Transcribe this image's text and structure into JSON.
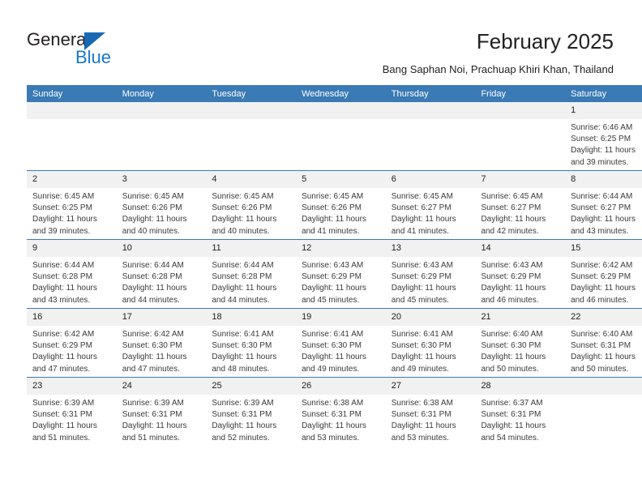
{
  "logo": {
    "word_top": "General",
    "word_bottom": "Blue",
    "triangle_color": "#1668b3",
    "bottom_color": "#1678c8"
  },
  "header": {
    "title": "February 2025",
    "subtitle": "Bang Saphan Noi, Prachuap Khiri Khan, Thailand",
    "accent_color": "#3a7ab5",
    "daynum_band_color": "#f1f1f1"
  },
  "weekday_headers": [
    "Sunday",
    "Monday",
    "Tuesday",
    "Wednesday",
    "Thursday",
    "Friday",
    "Saturday"
  ],
  "weeks": [
    [
      {
        "day": "",
        "lines": []
      },
      {
        "day": "",
        "lines": []
      },
      {
        "day": "",
        "lines": []
      },
      {
        "day": "",
        "lines": []
      },
      {
        "day": "",
        "lines": []
      },
      {
        "day": "",
        "lines": []
      },
      {
        "day": "1",
        "lines": [
          "Sunrise: 6:46 AM",
          "Sunset: 6:25 PM",
          "Daylight: 11 hours",
          "and 39 minutes."
        ]
      }
    ],
    [
      {
        "day": "2",
        "lines": [
          "Sunrise: 6:45 AM",
          "Sunset: 6:25 PM",
          "Daylight: 11 hours",
          "and 39 minutes."
        ]
      },
      {
        "day": "3",
        "lines": [
          "Sunrise: 6:45 AM",
          "Sunset: 6:26 PM",
          "Daylight: 11 hours",
          "and 40 minutes."
        ]
      },
      {
        "day": "4",
        "lines": [
          "Sunrise: 6:45 AM",
          "Sunset: 6:26 PM",
          "Daylight: 11 hours",
          "and 40 minutes."
        ]
      },
      {
        "day": "5",
        "lines": [
          "Sunrise: 6:45 AM",
          "Sunset: 6:26 PM",
          "Daylight: 11 hours",
          "and 41 minutes."
        ]
      },
      {
        "day": "6",
        "lines": [
          "Sunrise: 6:45 AM",
          "Sunset: 6:27 PM",
          "Daylight: 11 hours",
          "and 41 minutes."
        ]
      },
      {
        "day": "7",
        "lines": [
          "Sunrise: 6:45 AM",
          "Sunset: 6:27 PM",
          "Daylight: 11 hours",
          "and 42 minutes."
        ]
      },
      {
        "day": "8",
        "lines": [
          "Sunrise: 6:44 AM",
          "Sunset: 6:27 PM",
          "Daylight: 11 hours",
          "and 43 minutes."
        ]
      }
    ],
    [
      {
        "day": "9",
        "lines": [
          "Sunrise: 6:44 AM",
          "Sunset: 6:28 PM",
          "Daylight: 11 hours",
          "and 43 minutes."
        ]
      },
      {
        "day": "10",
        "lines": [
          "Sunrise: 6:44 AM",
          "Sunset: 6:28 PM",
          "Daylight: 11 hours",
          "and 44 minutes."
        ]
      },
      {
        "day": "11",
        "lines": [
          "Sunrise: 6:44 AM",
          "Sunset: 6:28 PM",
          "Daylight: 11 hours",
          "and 44 minutes."
        ]
      },
      {
        "day": "12",
        "lines": [
          "Sunrise: 6:43 AM",
          "Sunset: 6:29 PM",
          "Daylight: 11 hours",
          "and 45 minutes."
        ]
      },
      {
        "day": "13",
        "lines": [
          "Sunrise: 6:43 AM",
          "Sunset: 6:29 PM",
          "Daylight: 11 hours",
          "and 45 minutes."
        ]
      },
      {
        "day": "14",
        "lines": [
          "Sunrise: 6:43 AM",
          "Sunset: 6:29 PM",
          "Daylight: 11 hours",
          "and 46 minutes."
        ]
      },
      {
        "day": "15",
        "lines": [
          "Sunrise: 6:42 AM",
          "Sunset: 6:29 PM",
          "Daylight: 11 hours",
          "and 46 minutes."
        ]
      }
    ],
    [
      {
        "day": "16",
        "lines": [
          "Sunrise: 6:42 AM",
          "Sunset: 6:29 PM",
          "Daylight: 11 hours",
          "and 47 minutes."
        ]
      },
      {
        "day": "17",
        "lines": [
          "Sunrise: 6:42 AM",
          "Sunset: 6:30 PM",
          "Daylight: 11 hours",
          "and 47 minutes."
        ]
      },
      {
        "day": "18",
        "lines": [
          "Sunrise: 6:41 AM",
          "Sunset: 6:30 PM",
          "Daylight: 11 hours",
          "and 48 minutes."
        ]
      },
      {
        "day": "19",
        "lines": [
          "Sunrise: 6:41 AM",
          "Sunset: 6:30 PM",
          "Daylight: 11 hours",
          "and 49 minutes."
        ]
      },
      {
        "day": "20",
        "lines": [
          "Sunrise: 6:41 AM",
          "Sunset: 6:30 PM",
          "Daylight: 11 hours",
          "and 49 minutes."
        ]
      },
      {
        "day": "21",
        "lines": [
          "Sunrise: 6:40 AM",
          "Sunset: 6:30 PM",
          "Daylight: 11 hours",
          "and 50 minutes."
        ]
      },
      {
        "day": "22",
        "lines": [
          "Sunrise: 6:40 AM",
          "Sunset: 6:31 PM",
          "Daylight: 11 hours",
          "and 50 minutes."
        ]
      }
    ],
    [
      {
        "day": "23",
        "lines": [
          "Sunrise: 6:39 AM",
          "Sunset: 6:31 PM",
          "Daylight: 11 hours",
          "and 51 minutes."
        ]
      },
      {
        "day": "24",
        "lines": [
          "Sunrise: 6:39 AM",
          "Sunset: 6:31 PM",
          "Daylight: 11 hours",
          "and 51 minutes."
        ]
      },
      {
        "day": "25",
        "lines": [
          "Sunrise: 6:39 AM",
          "Sunset: 6:31 PM",
          "Daylight: 11 hours",
          "and 52 minutes."
        ]
      },
      {
        "day": "26",
        "lines": [
          "Sunrise: 6:38 AM",
          "Sunset: 6:31 PM",
          "Daylight: 11 hours",
          "and 53 minutes."
        ]
      },
      {
        "day": "27",
        "lines": [
          "Sunrise: 6:38 AM",
          "Sunset: 6:31 PM",
          "Daylight: 11 hours",
          "and 53 minutes."
        ]
      },
      {
        "day": "28",
        "lines": [
          "Sunrise: 6:37 AM",
          "Sunset: 6:31 PM",
          "Daylight: 11 hours",
          "and 54 minutes."
        ]
      },
      {
        "day": "",
        "lines": []
      }
    ]
  ]
}
